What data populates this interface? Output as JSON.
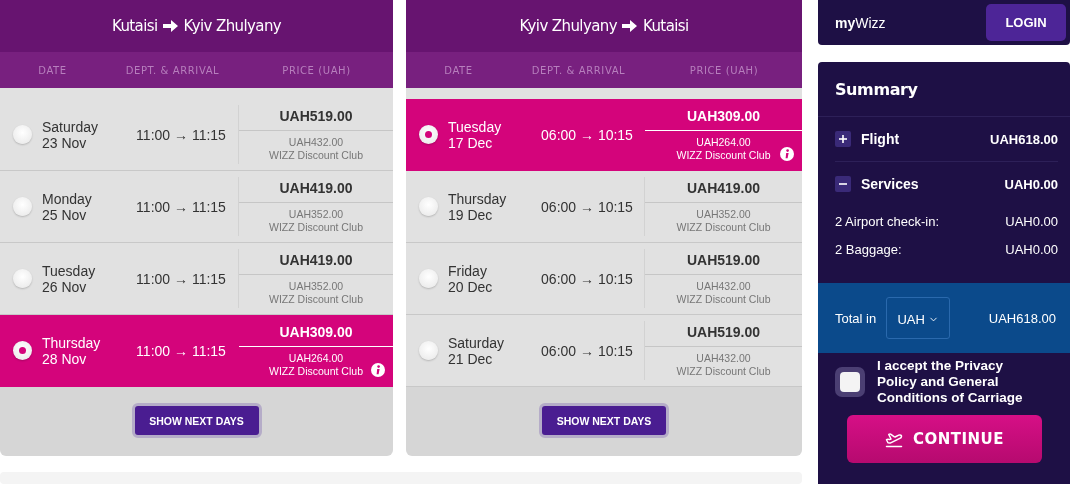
{
  "flights": [
    {
      "from": "Kutaisi",
      "to": "Kyiv Zhulyany",
      "columns": [
        "DATE",
        "DEPT. & ARRIVAL",
        "PRICE (UAH)"
      ],
      "days": [
        {
          "weekday": "Saturday",
          "date": "23 Nov",
          "time": "11:00 → 11:15",
          "price": "UAH519.00",
          "club_price": "UAH432.00",
          "club_label": "WIZZ Discount Club",
          "selected": false
        },
        {
          "weekday": "Monday",
          "date": "25 Nov",
          "time": "11:00 → 11:15",
          "price": "UAH419.00",
          "club_price": "UAH352.00",
          "club_label": "WIZZ Discount Club",
          "selected": false
        },
        {
          "weekday": "Tuesday",
          "date": "26 Nov",
          "time": "11:00 → 11:15",
          "price": "UAH419.00",
          "club_price": "UAH352.00",
          "club_label": "WIZZ Discount Club",
          "selected": false
        },
        {
          "weekday": "Thursday",
          "date": "28 Nov",
          "time": "11:00 → 11:15",
          "price": "UAH309.00",
          "club_price": "UAH264.00",
          "club_label": "WIZZ Discount Club",
          "selected": true
        }
      ],
      "more_button": "SHOW NEXT DAYS"
    },
    {
      "from": "Kyiv Zhulyany",
      "to": "Kutaisi",
      "columns": [
        "DATE",
        "DEPT. & ARRIVAL",
        "PRICE (UAH)"
      ],
      "days": [
        {
          "weekday": "Tuesday",
          "date": "17 Dec",
          "time": "06:00 → 10:15",
          "price": "UAH309.00",
          "club_price": "UAH264.00",
          "club_label": "WIZZ Discount Club",
          "selected": true
        },
        {
          "weekday": "Thursday",
          "date": "19 Dec",
          "time": "06:00 → 10:15",
          "price": "UAH419.00",
          "club_price": "UAH352.00",
          "club_label": "WIZZ Discount Club",
          "selected": false
        },
        {
          "weekday": "Friday",
          "date": "20 Dec",
          "time": "06:00 → 10:15",
          "price": "UAH519.00",
          "club_price": "UAH432.00",
          "club_label": "WIZZ Discount Club",
          "selected": false
        },
        {
          "weekday": "Saturday",
          "date": "21 Dec",
          "time": "06:00 → 10:15",
          "price": "UAH519.00",
          "club_price": "UAH432.00",
          "club_label": "WIZZ Discount Club",
          "selected": false
        }
      ],
      "more_button": "SHOW NEXT DAYS"
    }
  ],
  "mywizz": {
    "title": "**my**Wizz",
    "login": "LOGIN"
  },
  "summary": {
    "title": "Summary",
    "sections": [
      {
        "label": "Flight",
        "amount": "UAH618.00",
        "expanded": false
      },
      {
        "label": "Services",
        "amount": "UAH0.00",
        "expanded": true,
        "items": [
          {
            "label": "2 Airport check-in:",
            "amount": "UAH0.00"
          },
          {
            "label": "2 Baggage:",
            "amount": "UAH0.00"
          }
        ]
      }
    ],
    "total_label": "Total in",
    "currency": "UAH",
    "total": "UAH618.00",
    "accept": {
      "label": "I accept the Privacy Policy and General Conditions of Carriage",
      "checked": false
    },
    "continue": "CONTINUE"
  }
}
